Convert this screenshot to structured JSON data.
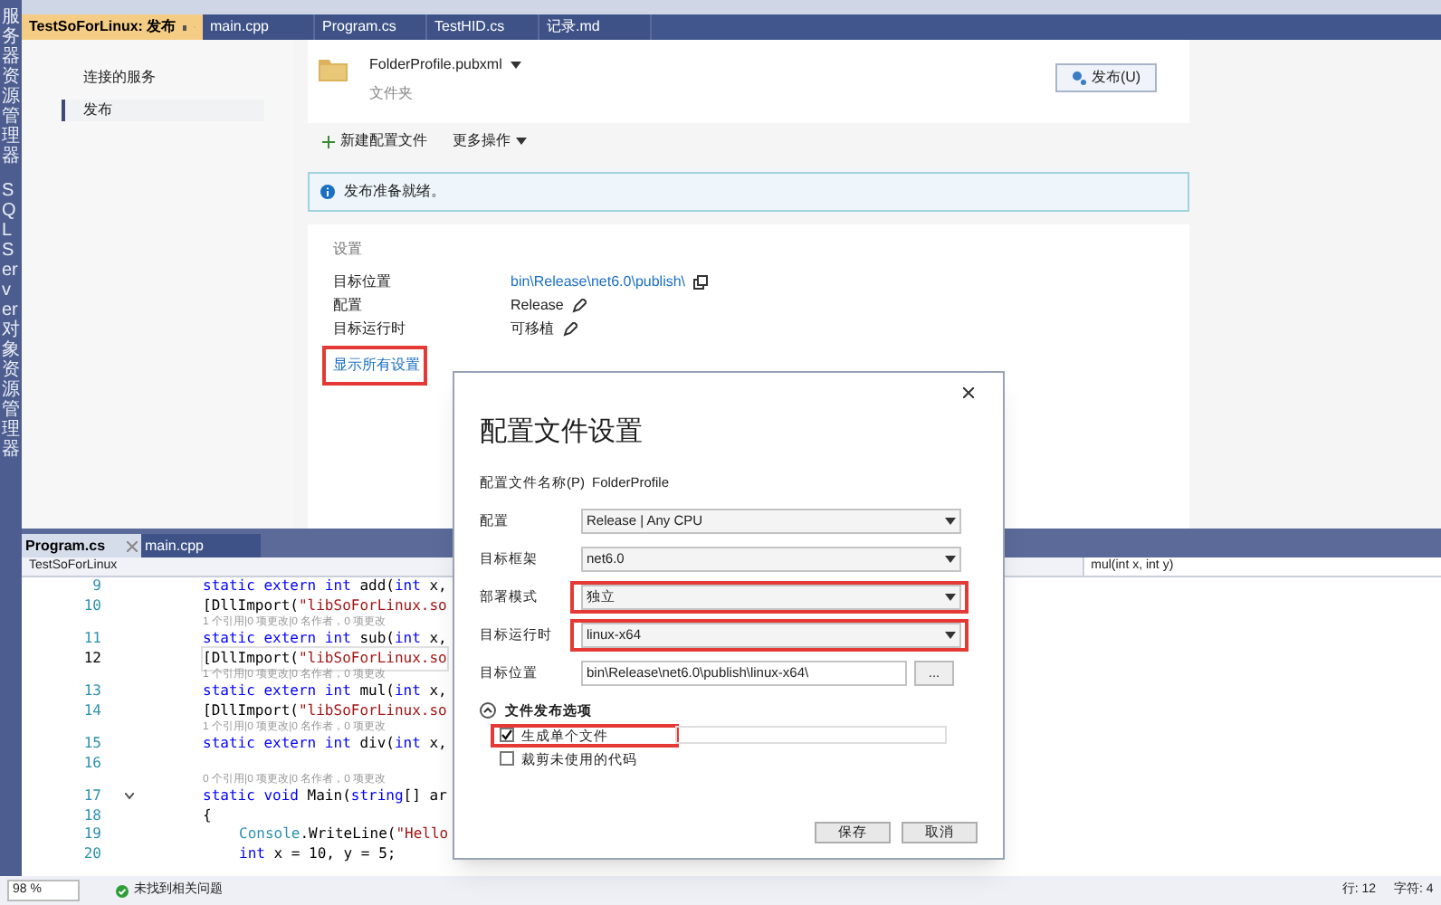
{
  "side_strip": {
    "labels": [
      "服务器资源管理器",
      "SQL Server 对象资源管理器"
    ]
  },
  "document_tabs": [
    {
      "label": "TestSoForLinux: 发布",
      "selected": true
    },
    {
      "label": "main.cpp",
      "selected": false
    },
    {
      "label": "Program.cs",
      "selected": false
    },
    {
      "label": "TestHID.cs",
      "selected": false
    },
    {
      "label": "记录.md",
      "selected": false
    }
  ],
  "publish_nav": {
    "items": [
      {
        "label": "连接的服务",
        "selected": false
      },
      {
        "label": "发布",
        "selected": true
      }
    ]
  },
  "profile": {
    "name": "FolderProfile.pubxml",
    "type": "文件夹",
    "publish_button": "发布(U)"
  },
  "toolbar": {
    "new_profile": "新建配置文件",
    "more_actions": "更多操作"
  },
  "info_bar": {
    "message": "发布准备就绪。"
  },
  "settings": {
    "title": "设置",
    "rows": [
      {
        "label": "目标位置",
        "value": "bin\\Release\\net6.0\\publish\\",
        "kind": "link"
      },
      {
        "label": "配置",
        "value": "Release",
        "kind": "edit"
      },
      {
        "label": "目标运行时",
        "value": "可移植",
        "kind": "edit"
      }
    ],
    "show_all_link": {
      "label": "显示所有设置",
      "highlighted": true
    }
  },
  "editor_tabs": [
    {
      "label": "Program.cs",
      "selected": true
    },
    {
      "label": "main.cpp",
      "selected": false
    }
  ],
  "editor_nav": {
    "project": "TestSoForLinux",
    "member": "mul(int x, int y)"
  },
  "code_lines": [
    {
      "number": "9",
      "tokens": [
        {
          "text": "static extern int ",
          "kind": "keyword"
        },
        {
          "text": "add(",
          "kind": "plain"
        },
        {
          "text": "int",
          "kind": "keyword"
        },
        {
          "text": " x,",
          "kind": "plain"
        }
      ]
    },
    {
      "number": "10",
      "tokens": [
        {
          "text": "[DllImport(",
          "kind": "plain"
        },
        {
          "text": "\"libSoForLinux.so",
          "kind": "string"
        }
      ]
    },
    {
      "lens": "1 个引用|0 项更改|0 名作者，0 项更改"
    },
    {
      "number": "11",
      "tokens": [
        {
          "text": "static extern int ",
          "kind": "keyword"
        },
        {
          "text": "sub(",
          "kind": "plain"
        },
        {
          "text": "int",
          "kind": "keyword"
        },
        {
          "text": " x,",
          "kind": "plain"
        }
      ]
    },
    {
      "number": "12",
      "current": true,
      "tokens": [
        {
          "text": "[DllImport(",
          "kind": "plain"
        },
        {
          "text": "\"libSoForLinux.so",
          "kind": "string"
        }
      ]
    },
    {
      "lens": "1 个引用|0 项更改|0 名作者，0 项更改"
    },
    {
      "number": "13",
      "tokens": [
        {
          "text": "static extern int ",
          "kind": "keyword"
        },
        {
          "text": "mul(",
          "kind": "plain"
        },
        {
          "text": "int",
          "kind": "keyword"
        },
        {
          "text": " x,",
          "kind": "plain"
        }
      ]
    },
    {
      "number": "14",
      "tokens": [
        {
          "text": "[DllImport(",
          "kind": "plain"
        },
        {
          "text": "\"libSoForLinux.so",
          "kind": "string"
        }
      ]
    },
    {
      "lens": "1 个引用|0 项更改|0 名作者，0 项更改"
    },
    {
      "number": "15",
      "tokens": [
        {
          "text": "static extern int ",
          "kind": "keyword"
        },
        {
          "text": "div(",
          "kind": "plain"
        },
        {
          "text": "int",
          "kind": "keyword"
        },
        {
          "text": " x,",
          "kind": "plain"
        }
      ]
    },
    {
      "number": "16"
    },
    {
      "lens": "0 个引用|0 项更改|0 名作者，0 项更改"
    },
    {
      "number": "17",
      "fold": true,
      "tokens": [
        {
          "text": "static void ",
          "kind": "keyword"
        },
        {
          "text": "Main(",
          "kind": "plain"
        },
        {
          "text": "string",
          "kind": "keyword"
        },
        {
          "text": "[] ar",
          "kind": "plain"
        }
      ]
    },
    {
      "number": "18",
      "tokens": [
        {
          "text": "{",
          "kind": "plain"
        }
      ]
    },
    {
      "number": "19",
      "indent": true,
      "tokens": [
        {
          "text": "Console",
          "kind": "type"
        },
        {
          "text": ".WriteLine(",
          "kind": "plain"
        },
        {
          "text": "\"Hello",
          "kind": "string"
        }
      ]
    },
    {
      "number": "20",
      "indent": true,
      "tokens": [
        {
          "text": "int",
          "kind": "keyword"
        },
        {
          "text": " x = 10, y = 5;",
          "kind": "plain"
        }
      ]
    }
  ],
  "status_bar": {
    "zoom": "98 %",
    "issues": "未找到相关问题",
    "line": "行: 12",
    "column": "字符: 4"
  },
  "dialog": {
    "title": "配置文件设置",
    "profile_label": "配置文件名称(P)",
    "profile_name": "FolderProfile",
    "fields": [
      {
        "label": "配置",
        "value": "Release | Any CPU",
        "kind": "select",
        "highlighted": false
      },
      {
        "label": "目标框架",
        "value": "net6.0",
        "kind": "select",
        "highlighted": false
      },
      {
        "label": "部署模式",
        "value": "独立",
        "kind": "select",
        "highlighted": true
      },
      {
        "label": "目标运行时",
        "value": "linux-x64",
        "kind": "select",
        "highlighted": true
      },
      {
        "label": "目标位置",
        "value": "bin\\Release\\net6.0\\publish\\linux-x64\\",
        "kind": "path",
        "browse": "..."
      }
    ],
    "section": {
      "title": "文件发布选项",
      "expanded": true
    },
    "options": [
      {
        "label": "生成单个文件",
        "checked": true,
        "highlighted": true
      },
      {
        "label": "裁剪未使用的代码",
        "checked": false,
        "highlighted": false
      }
    ],
    "buttons": [
      "保存",
      "取消"
    ]
  }
}
